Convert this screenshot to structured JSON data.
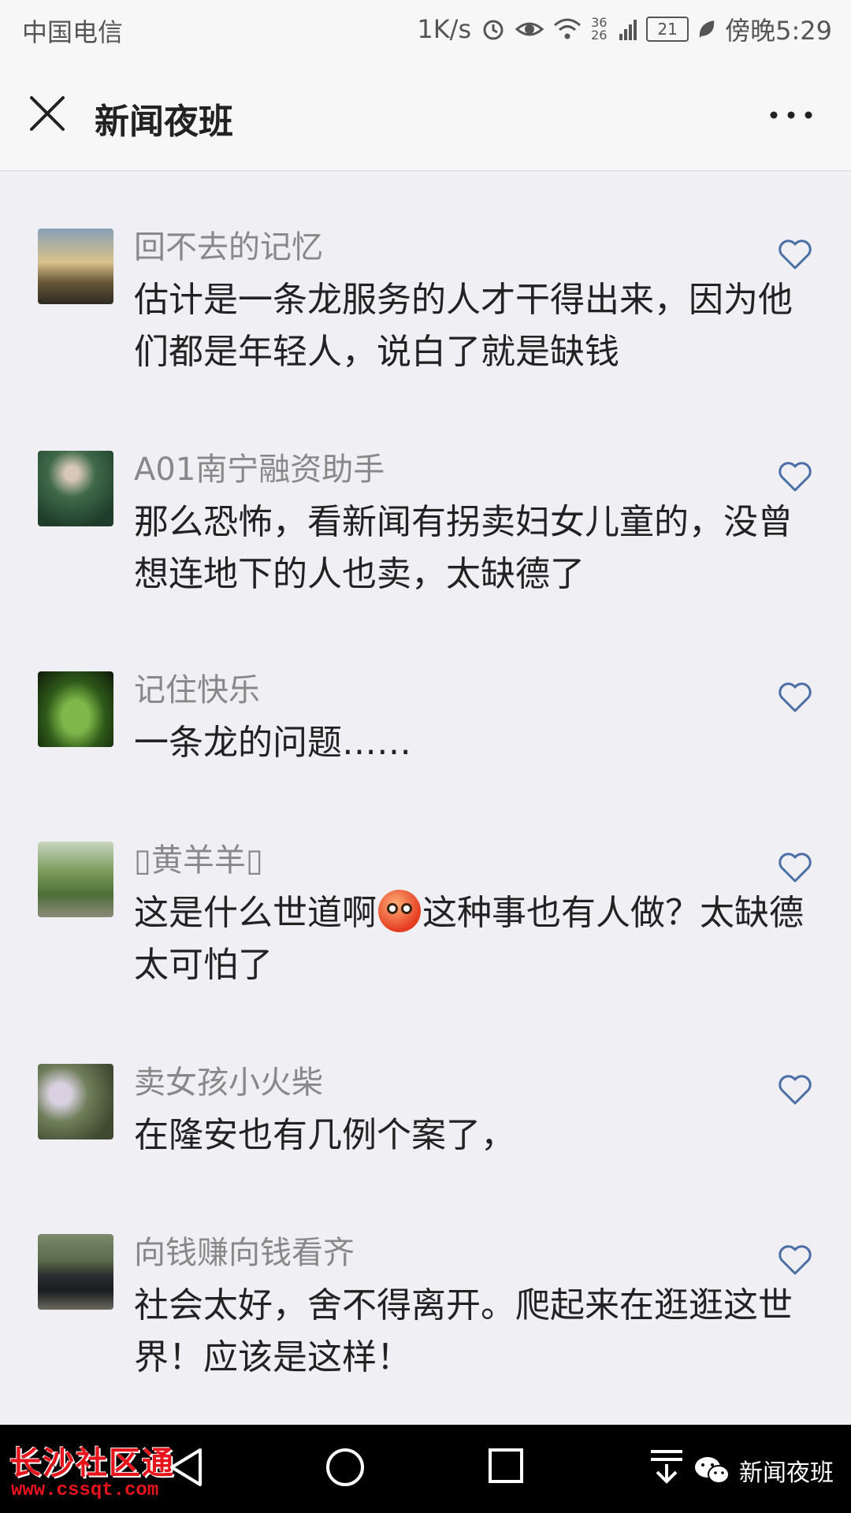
{
  "status_bar": {
    "carrier": "中国电信",
    "net_speed": "1K/s",
    "signal_label": "36 26",
    "battery": "21",
    "time": "傍晚5:29"
  },
  "header": {
    "title": "新闻夜班"
  },
  "comments": [
    {
      "nickname": "回不去的记忆",
      "text": "估计是一条龙服务的人才干得出来，因为他们都是年轻人，说白了就是缺钱"
    },
    {
      "nickname": "A01南宁融资助手",
      "text": "那么恐怖，看新闻有拐卖妇女儿童的，没曾想连地下的人也卖，太缺德了"
    },
    {
      "nickname": "记住快乐",
      "text": "一条龙的问题……"
    },
    {
      "nickname": "▯黄羊羊▯",
      "text_before": "这是什么世道啊",
      "text_after": "这种事也有人做？太缺德太可怕了"
    },
    {
      "nickname": "卖女孩小火柴",
      "text": "在隆安也有几例个案了，"
    },
    {
      "nickname": "向钱赚向钱看齐",
      "text": "社会太好，舍不得离开。爬起来在逛逛这世界！应该是这样！"
    }
  ],
  "watermark": {
    "left_text": "长沙社区通",
    "left_url": "www.cssqt.com",
    "right_text": "新闻夜班"
  },
  "colors": {
    "background": "#efeff4",
    "heart_outline": "#4a6fa5",
    "watermark_red": "#e8141c"
  },
  "icons": {
    "close": "close-icon",
    "more": "more-dots-icon",
    "like": "heart-outline-icon",
    "back": "back-triangle-icon",
    "home": "home-circle-icon",
    "recents": "recents-square-icon",
    "dropdown": "pull-down-icon",
    "wechat": "wechat-icon"
  }
}
